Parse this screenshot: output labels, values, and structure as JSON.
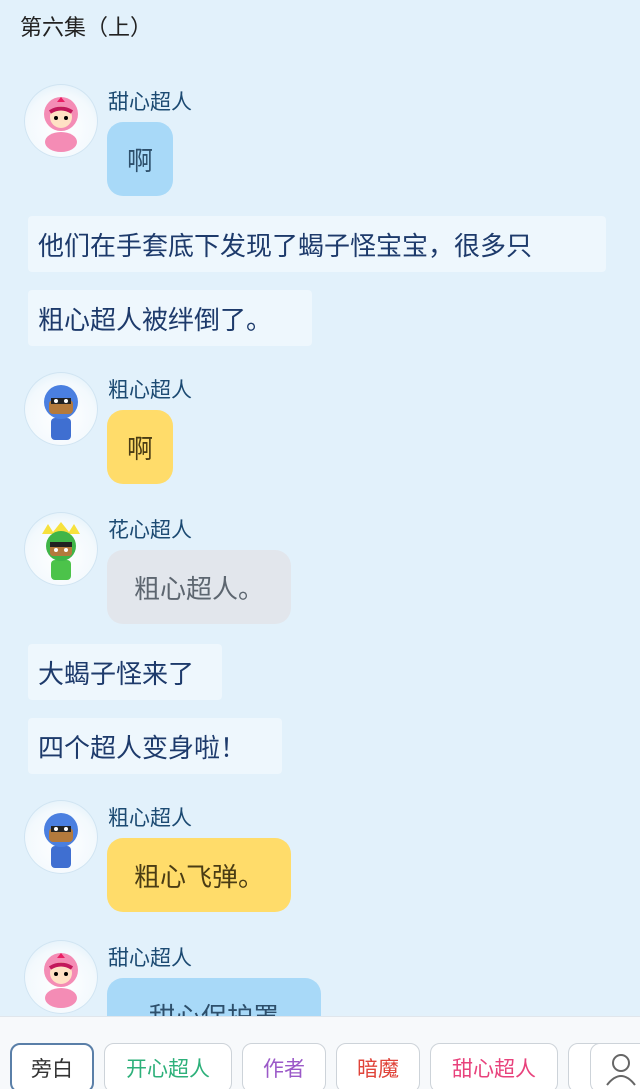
{
  "header": {
    "title": "第六集（上）"
  },
  "messages": [
    {
      "type": "speech",
      "speaker": "甜心超人",
      "text": "啊",
      "bubble_color": "#a8d9f8"
    },
    {
      "type": "narration",
      "text": "他们在手套底下发现了蝎子怪宝宝，很多只"
    },
    {
      "type": "narration",
      "text": "粗心超人被绊倒了。"
    },
    {
      "type": "speech",
      "speaker": "粗心超人",
      "text": "啊",
      "bubble_color": "#ffdc6a"
    },
    {
      "type": "speech",
      "speaker": "花心超人",
      "text": "粗心超人。",
      "bubble_color": "#e2e6ec"
    },
    {
      "type": "narration",
      "text": "大蝎子怪来了"
    },
    {
      "type": "narration",
      "text": "四个超人变身啦！"
    },
    {
      "type": "speech",
      "speaker": "粗心超人",
      "text": "粗心飞弹。",
      "bubble_color": "#ffdc6a"
    },
    {
      "type": "speech",
      "speaker": "甜心超人",
      "text": "甜心保护罩",
      "bubble_color": "#a8d9f8"
    }
  ],
  "tabs": [
    {
      "label": "旁白",
      "color": "#333333",
      "active": true
    },
    {
      "label": "开心超人",
      "color": "#2db07a"
    },
    {
      "label": "作者",
      "color": "#9b59c8"
    },
    {
      "label": "暗魔",
      "color": "#e0443a"
    },
    {
      "label": "甜心超人",
      "color": "#e8427c"
    }
  ],
  "icons": {
    "profile": "user-icon"
  }
}
